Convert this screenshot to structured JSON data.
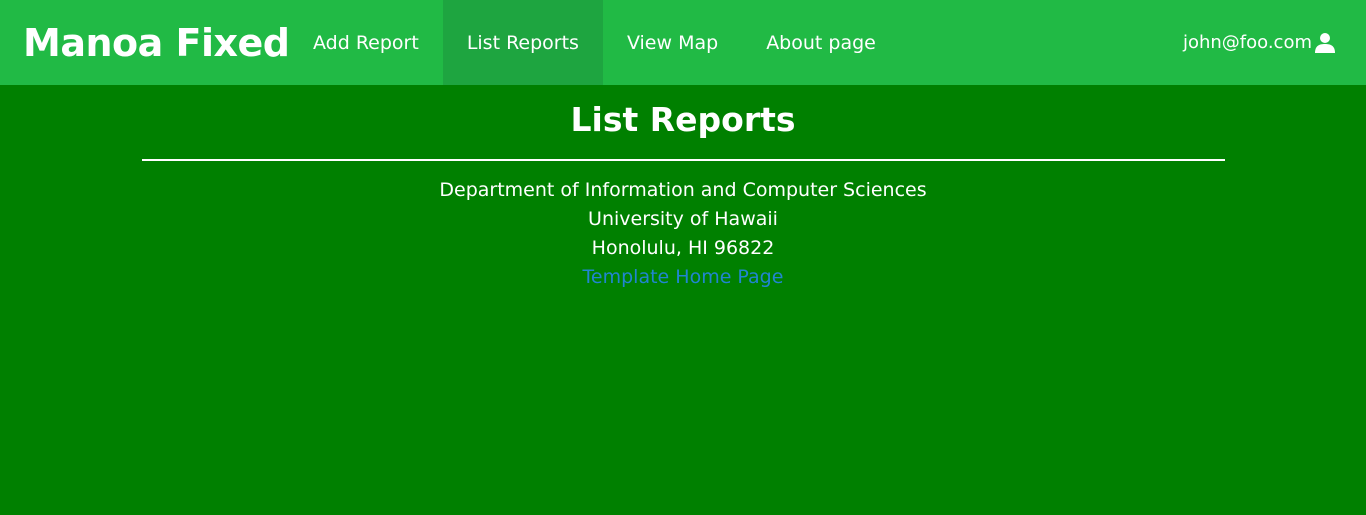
{
  "navbar": {
    "brand": "Manoa Fixed",
    "items": [
      {
        "label": "Add Report"
      },
      {
        "label": "List Reports"
      },
      {
        "label": "View Map"
      },
      {
        "label": "About page"
      }
    ],
    "user_email": "john@foo.com",
    "user_icon": "user-icon",
    "background": "#21ba45",
    "active_background": "#1ea540"
  },
  "page": {
    "title": "List Reports",
    "background": "#008000"
  },
  "footer": {
    "line1": "Department of Information and Computer Sciences",
    "line2": "University of Hawaii",
    "line3": "Honolulu, HI 96822",
    "link_text": "Template Home Page",
    "link_color": "#2185d0"
  }
}
